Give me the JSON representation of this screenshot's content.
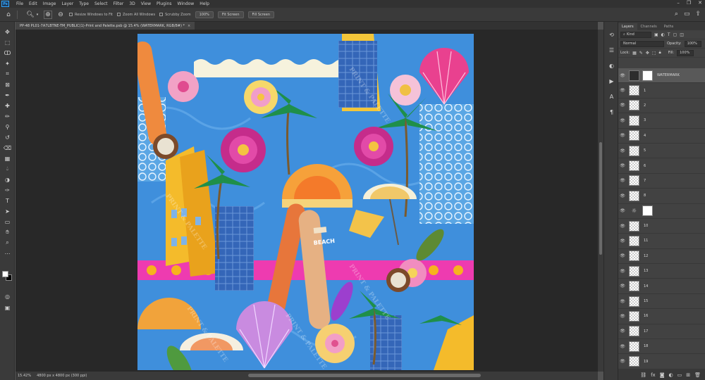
{
  "app": {
    "logo": "Ps"
  },
  "menu": [
    "File",
    "Edit",
    "Image",
    "Layer",
    "Type",
    "Select",
    "Filter",
    "3D",
    "View",
    "Plugins",
    "Window",
    "Help"
  ],
  "options": {
    "checkbox1": "Resize Windows to Fit",
    "checkbox2": "Zoom All Windows",
    "checkbox3": "Scrubby Zoom",
    "zoom_value": "100%",
    "fit_screen": "Fit Screen",
    "fill_screen": "Fill Screen"
  },
  "document": {
    "tab_title": "PP-48 PL01-7A7LBTNE-TM_PUBLIC(1)-Print and Palette.psb @ 15.4% (WATERMARK, RGB/8#) *",
    "zoom_status": "15.42%",
    "doc_info": "4800 px x 4800 px (300 ppi)"
  },
  "layers_panel": {
    "tabs": [
      "Layers",
      "Channels",
      "Paths"
    ],
    "filter_kind": "Kind",
    "blend_mode": "Normal",
    "opacity_label": "Opacity:",
    "opacity_value": "100%",
    "lock_label": "Lock:",
    "fill_label": "Fill:",
    "fill_value": "100%",
    "layers": [
      {
        "name": "WATERMARK",
        "thumb": "dark",
        "selected": true,
        "has_mask": true
      },
      {
        "name": "1",
        "thumb": "trans"
      },
      {
        "name": "2",
        "thumb": "trans"
      },
      {
        "name": "3",
        "thumb": "trans"
      },
      {
        "name": "4",
        "thumb": "trans"
      },
      {
        "name": "5",
        "thumb": "trans"
      },
      {
        "name": "6",
        "thumb": "trans"
      },
      {
        "name": "7",
        "thumb": "trans"
      },
      {
        "name": "8",
        "thumb": "trans"
      },
      {
        "name": "",
        "thumb": "adjust",
        "has_mask": true
      },
      {
        "name": "10",
        "thumb": "trans"
      },
      {
        "name": "11",
        "thumb": "trans"
      },
      {
        "name": "12",
        "thumb": "trans"
      },
      {
        "name": "13",
        "thumb": "trans"
      },
      {
        "name": "14",
        "thumb": "trans"
      },
      {
        "name": "15",
        "thumb": "trans"
      },
      {
        "name": "16",
        "thumb": "trans"
      },
      {
        "name": "17",
        "thumb": "trans"
      },
      {
        "name": "18",
        "thumb": "trans"
      },
      {
        "name": "19",
        "thumb": "trans"
      }
    ]
  },
  "artwork": {
    "watermark_text": "PRINT & PALETTE",
    "sign_text": "BEACH"
  },
  "colors": {
    "accent": "#31a8ff",
    "canvas_bg": "#282828",
    "artwork_bg": "#3f8fdc"
  }
}
